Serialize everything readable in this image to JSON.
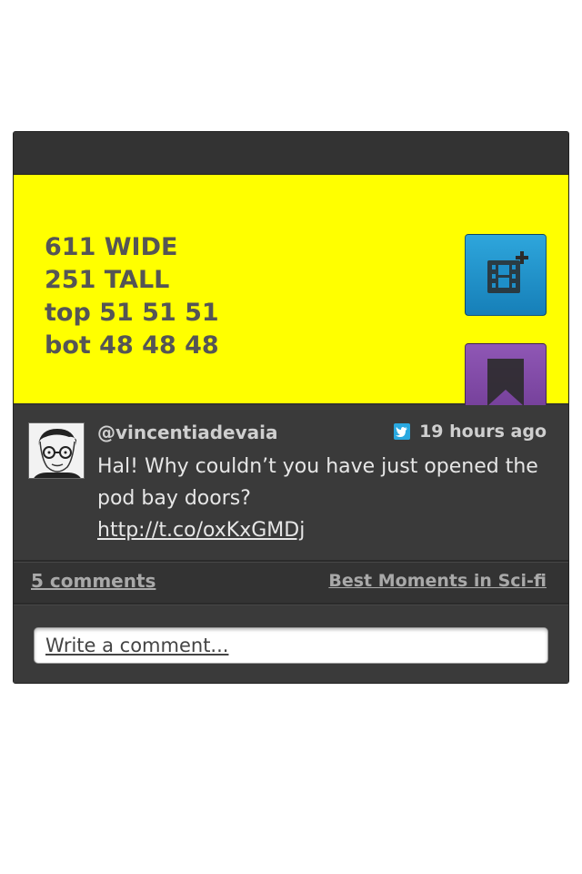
{
  "media": {
    "lines": [
      "611 WIDE",
      "251 TALL",
      "top 51 51 51",
      "bot 48 48 48"
    ],
    "background": "#ffff00"
  },
  "actions": {
    "video_icon": "film-add-icon",
    "save_icon": "bookmark-icon",
    "video_color": "#1e8fc8",
    "save_color": "#7f47a6"
  },
  "post": {
    "username": "@vincentiadevaia",
    "time": "19 hours ago",
    "source_icon": "twitter-icon",
    "text": "Hal! Why couldn’t you have just opened the pod bay doors?",
    "link": "http://t.co/oxKxGMDj"
  },
  "footer": {
    "comments": "5 comments",
    "collection": "Best Moments in Sci-fi"
  },
  "comment_box": {
    "placeholder": "Write a comment..."
  }
}
